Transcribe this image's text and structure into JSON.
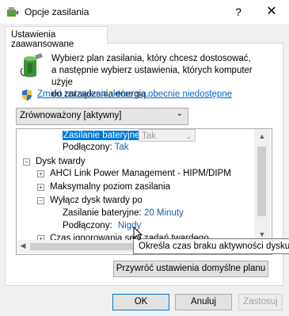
{
  "window": {
    "title": "Opcje zasilania",
    "help_label": "?",
    "close_label": "✕"
  },
  "tab": {
    "label": "Ustawienia zaawansowane"
  },
  "intro": {
    "lines": [
      "Wybierz plan zasilania, który chcesz dostosować,",
      "a następnie wybierz ustawienia, których komputer użyje",
      "do zarządzania energią."
    ]
  },
  "change_link": "Zmień ustawienia, które są obecnie niedostępne",
  "plan_select": {
    "value": "Zrównoważony [aktywny]"
  },
  "tree": {
    "row1": {
      "label": "Zasilanie bateryjne:",
      "value": "Tak"
    },
    "row2": {
      "label": "Podłączony:",
      "value": "Tak"
    },
    "row3": {
      "label": "Dysk twardy",
      "toggle": "−"
    },
    "row4": {
      "label": "AHCI Link Power Management - HIPM/DIPM",
      "toggle": "+"
    },
    "row5": {
      "label": "Maksymalny poziom zasilania",
      "toggle": "+"
    },
    "row6": {
      "label": "Wyłącz dysk twardy po",
      "toggle": "−"
    },
    "row7": {
      "label": "Zasilanie bateryjne:",
      "value": "20 Minuty"
    },
    "row8": {
      "label": "Podłączony:",
      "value": "Nigdy"
    },
    "row9": {
      "label": "Czas ignorowania serii zadań twardego",
      "toggle": "+"
    }
  },
  "tooltip": "Określa czas braku aktywności dysku tw",
  "buttons": {
    "restore": "Przywróć ustawienia domyślne planu",
    "ok": "OK",
    "cancel": "Anuluj",
    "apply": "Zastosuj"
  },
  "colors": {
    "accent": "#0078d7",
    "link": "#0066cc",
    "value": "#1a5fb4"
  }
}
